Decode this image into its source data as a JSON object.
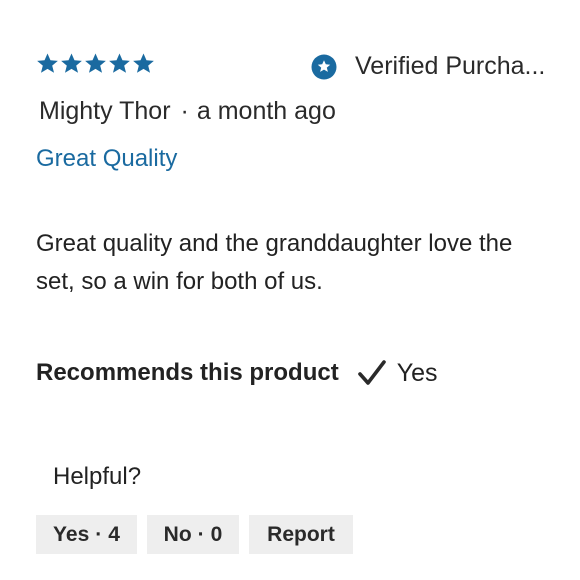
{
  "review": {
    "rating": 5,
    "rating_max": 5,
    "star_color": "#1a6aa0",
    "verified_icon": "star-badge-icon",
    "verified_text": "Verified Purcha...",
    "author": "Mighty Thor",
    "separator": "·",
    "time_ago": "a month ago",
    "title": "Great Quality",
    "title_color": "#1a6aa0",
    "body": "Great quality and the granddaughter love the set, so a win for both of us.",
    "recommend": {
      "label": "Recommends this product",
      "icon": "checkmark-icon",
      "value": "Yes"
    },
    "feedback": {
      "helpful_label": "Helpful?",
      "yes_label": "Yes",
      "yes_count": "4",
      "no_label": "No",
      "no_count": "0",
      "report_label": "Report"
    }
  }
}
